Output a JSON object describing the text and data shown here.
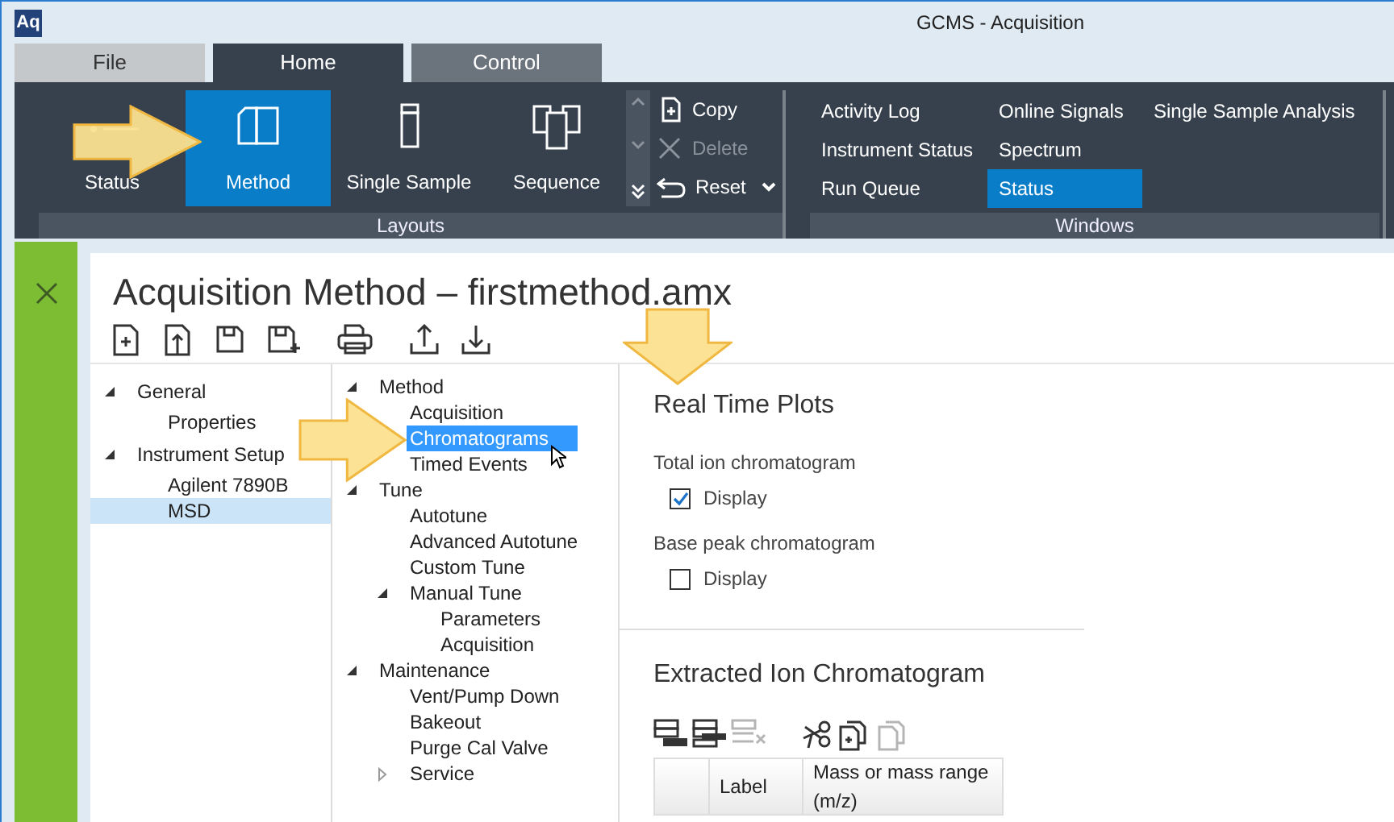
{
  "window": {
    "logo": "Aq",
    "title": "GCMS - Acquisition"
  },
  "tabs": [
    {
      "label": "File",
      "kind": "backstage",
      "selected": false
    },
    {
      "label": "Home",
      "kind": "page",
      "selected": true
    },
    {
      "label": "Control",
      "kind": "page",
      "selected": false
    }
  ],
  "ribbon": {
    "layouts": {
      "label": "Layouts",
      "buttons": [
        {
          "label": "Status",
          "selected": false
        },
        {
          "label": "Method",
          "selected": true
        },
        {
          "label": "Single Sample",
          "selected": false
        },
        {
          "label": "Sequence",
          "selected": false
        }
      ],
      "actions": [
        {
          "label": "Copy",
          "disabled": false,
          "dropdown": false
        },
        {
          "label": "Delete",
          "disabled": true,
          "dropdown": false
        },
        {
          "label": "Reset",
          "disabled": false,
          "dropdown": true
        }
      ]
    },
    "windows": {
      "label": "Windows",
      "columns": [
        [
          {
            "label": "Activity Log",
            "selected": false
          },
          {
            "label": "Instrument Status",
            "selected": false
          },
          {
            "label": "Run Queue",
            "selected": false
          }
        ],
        [
          {
            "label": "Online Signals",
            "selected": false
          },
          {
            "label": "Spectrum",
            "selected": false
          },
          {
            "label": "Status",
            "selected": true
          }
        ],
        [
          {
            "label": "Single Sample Analysis",
            "selected": false
          }
        ]
      ]
    }
  },
  "panel": {
    "title": "Acquisition Method – firstmethod.amx",
    "nav_tree": {
      "focused": false,
      "items": [
        {
          "label": "General",
          "expanded": true,
          "selected": false,
          "children": [
            {
              "label": "Properties",
              "selected": false
            }
          ]
        },
        {
          "label": "Instrument Setup",
          "expanded": true,
          "selected": false,
          "children": [
            {
              "label": "Agilent 7890B",
              "selected": false
            },
            {
              "label": "MSD",
              "selected": true
            }
          ]
        }
      ]
    },
    "method_tree": {
      "focused": true,
      "items": [
        {
          "label": "Method",
          "expanded": true,
          "selected": false,
          "children": [
            {
              "label": "Acquisition",
              "selected": false
            },
            {
              "label": "Chromatograms",
              "selected": true
            },
            {
              "label": "Timed Events",
              "selected": false
            }
          ]
        },
        {
          "label": "Tune",
          "expanded": true,
          "selected": false,
          "children": [
            {
              "label": "Autotune",
              "selected": false
            },
            {
              "label": "Advanced Autotune",
              "selected": false
            },
            {
              "label": "Custom Tune",
              "selected": false
            },
            {
              "label": "Manual Tune",
              "expanded": true,
              "selected": false,
              "children": [
                {
                  "label": "Parameters",
                  "selected": false
                },
                {
                  "label": "Acquisition",
                  "selected": false
                }
              ]
            }
          ]
        },
        {
          "label": "Maintenance",
          "expanded": true,
          "selected": false,
          "children": [
            {
              "label": "Vent/Pump Down",
              "selected": false
            },
            {
              "label": "Bakeout",
              "selected": false
            },
            {
              "label": "Purge Cal Valve",
              "selected": false
            },
            {
              "label": "Service",
              "expanded": false,
              "selected": false
            }
          ]
        }
      ]
    },
    "real_time_plots": {
      "title": "Real Time Plots",
      "options": [
        {
          "label": "Total ion chromatogram",
          "option": "Display",
          "checked": true
        },
        {
          "label": "Base peak chromatogram",
          "option": "Display",
          "checked": false
        }
      ]
    },
    "extracted_ion": {
      "title": "Extracted Ion Chromatogram",
      "tools": [
        {
          "disabled": false
        },
        {
          "disabled": false
        },
        {
          "disabled": true
        },
        {
          "disabled": false
        },
        {
          "disabled": false
        },
        {
          "disabled": true
        }
      ],
      "columns": [
        "Label",
        "Mass or mass range (m/z)"
      ]
    }
  },
  "callouts": [
    {
      "kind": "right-arrow"
    },
    {
      "kind": "right-arrow"
    },
    {
      "kind": "down-arrow"
    }
  ]
}
